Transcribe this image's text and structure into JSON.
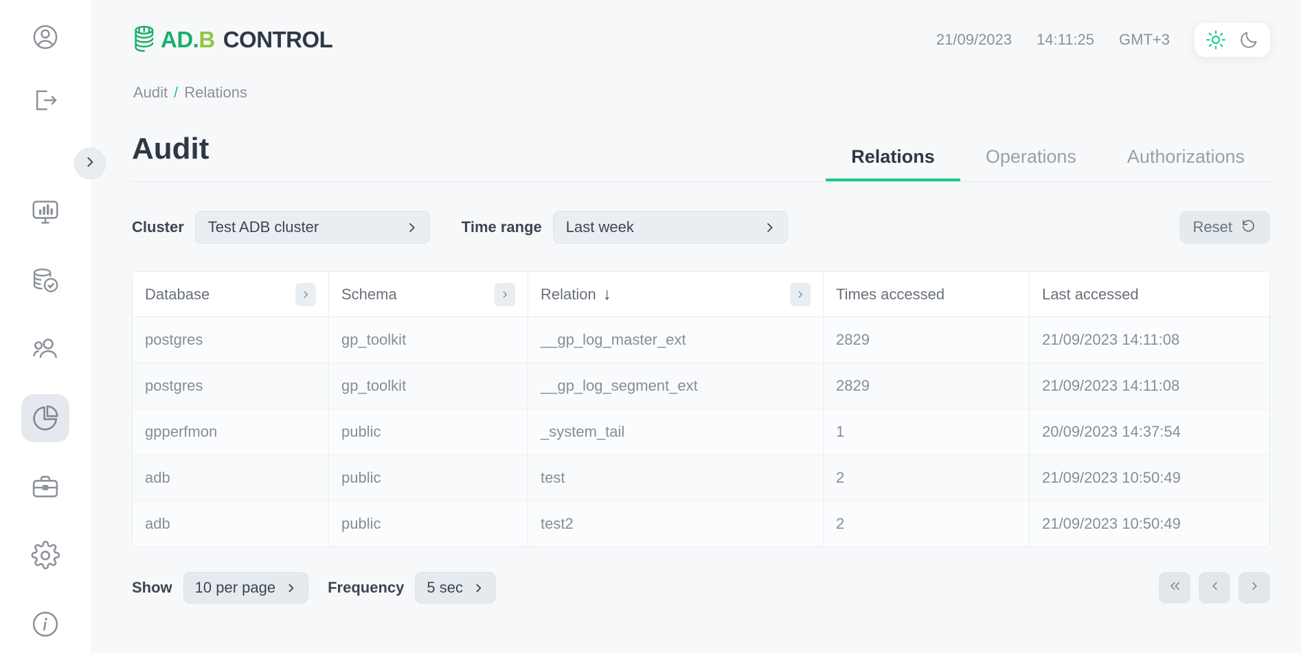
{
  "sidebar": {
    "top_items": [
      {
        "name": "profile",
        "icon": "user-circle-icon"
      },
      {
        "name": "logout",
        "icon": "logout-icon"
      }
    ],
    "nav_items": [
      {
        "name": "monitoring",
        "icon": "monitor-chart-icon",
        "active": false
      },
      {
        "name": "backup",
        "icon": "database-check-icon",
        "active": false
      },
      {
        "name": "users",
        "icon": "users-icon",
        "active": false
      },
      {
        "name": "audit",
        "icon": "pie-chart-icon",
        "active": true
      },
      {
        "name": "toolbox",
        "icon": "briefcase-icon",
        "active": false
      },
      {
        "name": "settings",
        "icon": "gear-icon",
        "active": false
      },
      {
        "name": "about",
        "icon": "info-circle-icon",
        "active": false
      }
    ],
    "expand_toggle_icon": "chevron-right-icon"
  },
  "header": {
    "logo": {
      "icon": "database-stack-icon",
      "part1": "AD.",
      "part2": "B",
      "part3": "CONTROL"
    },
    "date": "21/09/2023",
    "time": "14:11:25",
    "timezone": "GMT+3",
    "theme": {
      "light_icon": "sun-icon",
      "dark_icon": "moon-icon",
      "active": "light"
    }
  },
  "breadcrumb": {
    "root": "Audit",
    "separator": "/",
    "current": "Relations"
  },
  "page": {
    "title": "Audit",
    "tabs": [
      {
        "label": "Relations",
        "active": true
      },
      {
        "label": "Operations",
        "active": false
      },
      {
        "label": "Authorizations",
        "active": false
      }
    ]
  },
  "filters": {
    "cluster_label": "Cluster",
    "cluster_value": "Test ADB cluster",
    "timerange_label": "Time range",
    "timerange_value": "Last week",
    "reset_label": "Reset",
    "reset_icon": "refresh-ccw-icon"
  },
  "table": {
    "columns": [
      {
        "label": "Database",
        "filterable": true,
        "sorted": false
      },
      {
        "label": "Schema",
        "filterable": true,
        "sorted": false
      },
      {
        "label": "Relation",
        "filterable": true,
        "sorted": true,
        "sort_icon": "↓"
      },
      {
        "label": "Times accessed",
        "filterable": false,
        "sorted": false
      },
      {
        "label": "Last accessed",
        "filterable": false,
        "sorted": false
      }
    ],
    "rows": [
      {
        "database": "postgres",
        "schema": "gp_toolkit",
        "relation": "__gp_log_master_ext",
        "times_accessed": "2829",
        "last_accessed": "21/09/2023 14:11:08"
      },
      {
        "database": "postgres",
        "schema": "gp_toolkit",
        "relation": "__gp_log_segment_ext",
        "times_accessed": "2829",
        "last_accessed": "21/09/2023 14:11:08"
      },
      {
        "database": "gpperfmon",
        "schema": "public",
        "relation": "_system_tail",
        "times_accessed": "1",
        "last_accessed": "20/09/2023 14:37:54"
      },
      {
        "database": "adb",
        "schema": "public",
        "relation": "test",
        "times_accessed": "2",
        "last_accessed": "21/09/2023 10:50:49"
      },
      {
        "database": "adb",
        "schema": "public",
        "relation": "test2",
        "times_accessed": "2",
        "last_accessed": "21/09/2023 10:50:49"
      }
    ]
  },
  "footer": {
    "show_label": "Show",
    "per_page_value": "10 per page",
    "frequency_label": "Frequency",
    "frequency_value": "5 sec",
    "pagination": [
      {
        "name": "first-page",
        "icon": "chevrons-left-icon"
      },
      {
        "name": "prev-page",
        "icon": "chevron-left-icon"
      },
      {
        "name": "next-page",
        "icon": "chevron-right-icon"
      }
    ]
  },
  "colors": {
    "accent": "#16c98d",
    "brand_green": "#19b06a",
    "brand_lime": "#8dc63f",
    "text_dark": "#2e3845",
    "text_muted": "#8b9099"
  }
}
